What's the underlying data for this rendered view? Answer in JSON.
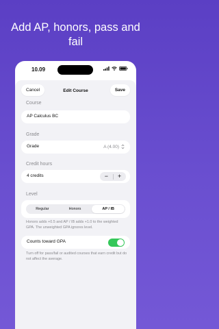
{
  "headline": "Add AP, honors, pass and fail",
  "status_bar": {
    "time": "10.09"
  },
  "nav": {
    "cancel_label": "Cancel",
    "title": "Edit Course",
    "save_label": "Save"
  },
  "course": {
    "label": "Course",
    "value": "AP Calculus BC"
  },
  "grade": {
    "label": "Grade",
    "field_label": "Grade",
    "value": "A (4.00)"
  },
  "credit_hours": {
    "label": "Credit hours",
    "value": "4 credits",
    "minus": "−",
    "plus": "+"
  },
  "level": {
    "label": "Level",
    "options": [
      "Regular",
      "Honors",
      "AP / IB"
    ],
    "selected": "AP / IB",
    "help": "Honors adds +0.5 and AP / IB adds +1.0 to the weighted GPA. The unweighted GPA ignores level."
  },
  "gpa_toggle": {
    "label": "Counts toward GPA",
    "on": true,
    "help": "Turn off for pass/fail or audited courses that earn credit but do not affect the average."
  },
  "colors": {
    "background": "#5b3fc4",
    "toggle_on": "#34c759",
    "sheet": "#f2f2f6"
  }
}
